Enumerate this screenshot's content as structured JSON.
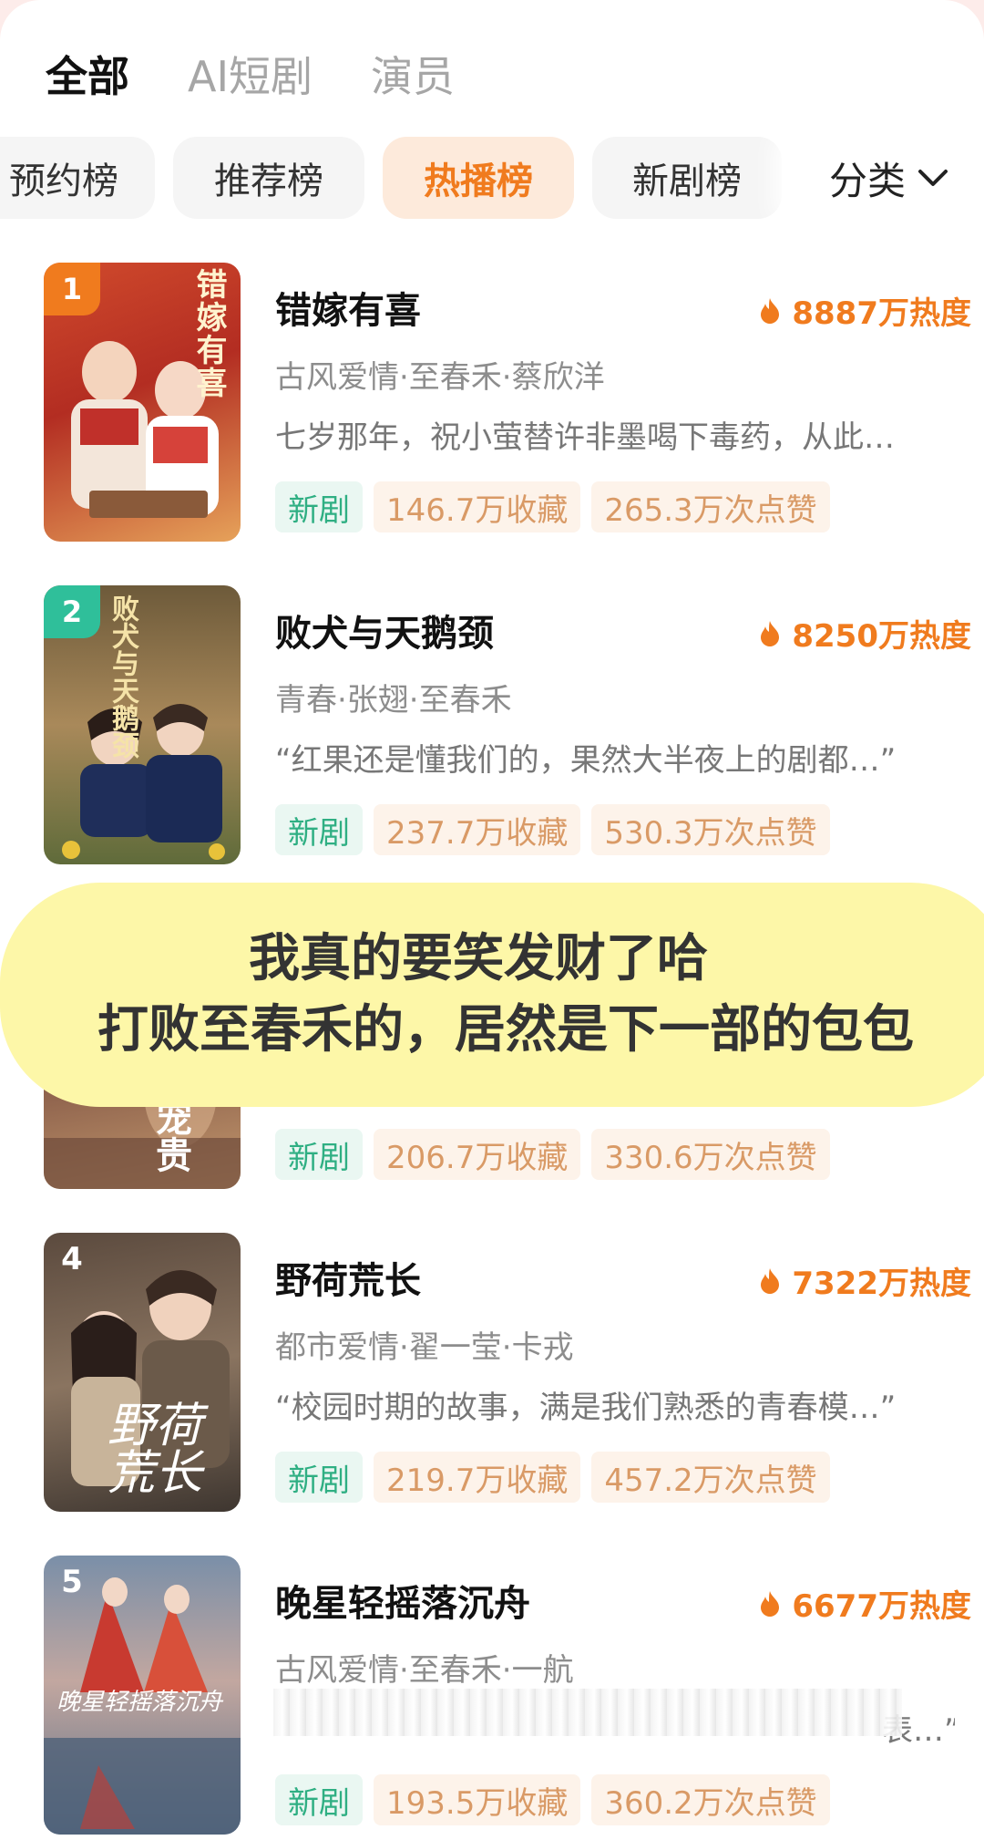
{
  "top_tabs": [
    {
      "label": "全部",
      "active": true
    },
    {
      "label": "AI短剧",
      "active": false
    },
    {
      "label": "演员",
      "active": false
    }
  ],
  "chips": [
    {
      "label": "预约榜",
      "active": false
    },
    {
      "label": "推荐榜",
      "active": false
    },
    {
      "label": "热播榜",
      "active": true
    },
    {
      "label": "新剧榜",
      "active": false
    }
  ],
  "category_label": "分类",
  "items": [
    {
      "rank": "1",
      "title": "错嫁有喜",
      "heat": "8887万热度",
      "meta": "古风爱情·至春禾·蔡欣洋",
      "desc": "七岁那年，祝小萤替许非墨喝下毒药，从此…",
      "tag_new": "新剧",
      "collect": "146.7万收藏",
      "likes": "265.3万次点赞",
      "cover_text": "错嫁有喜"
    },
    {
      "rank": "2",
      "title": "败犬与天鹅颈",
      "heat": "8250万热度",
      "meta": "青春·张翅·至春禾",
      "desc": "“红果还是懂我们的，果然大半夜上的剧都…”",
      "tag_new": "新剧",
      "collect": "237.7万收藏",
      "likes": "530.3万次点赞",
      "cover_text": "败犬与天鹅颈"
    },
    {
      "tag_new": "新剧",
      "collect": "206.7万收藏",
      "likes": "330.6万次点赞",
      "cover_text": "宠贵"
    },
    {
      "rank": "4",
      "title": "野荷荒长",
      "heat": "7322万热度",
      "meta": "都市爱情·翟一莹·卡戎",
      "desc": "“校园时期的故事，满是我们熟悉的青春模…”",
      "tag_new": "新剧",
      "collect": "219.7万收藏",
      "likes": "457.2万次点赞",
      "cover_text": "野荷荒长"
    },
    {
      "rank": "5",
      "title": "晚星轻摇落沉舟",
      "heat": "6677万热度",
      "meta": "古风爱情·至春禾·一航",
      "desc": "表…”",
      "tag_new": "新剧",
      "collect": "193.5万收藏",
      "likes": "360.2万次点赞",
      "cover_text": "晚星轻摇落沉舟"
    }
  ],
  "overlay": {
    "line1": "我真的要笑发财了哈",
    "line2": "打败至春禾的，居然是下一部的包包"
  },
  "colors": {
    "accent": "#f07b1e",
    "rank1": "#f07b1e",
    "rank2": "#2fbf9a",
    "tag_new_text": "#2faf83",
    "tag_stat_text": "#d99a66",
    "overlay_bg": "#fdf7a8"
  }
}
